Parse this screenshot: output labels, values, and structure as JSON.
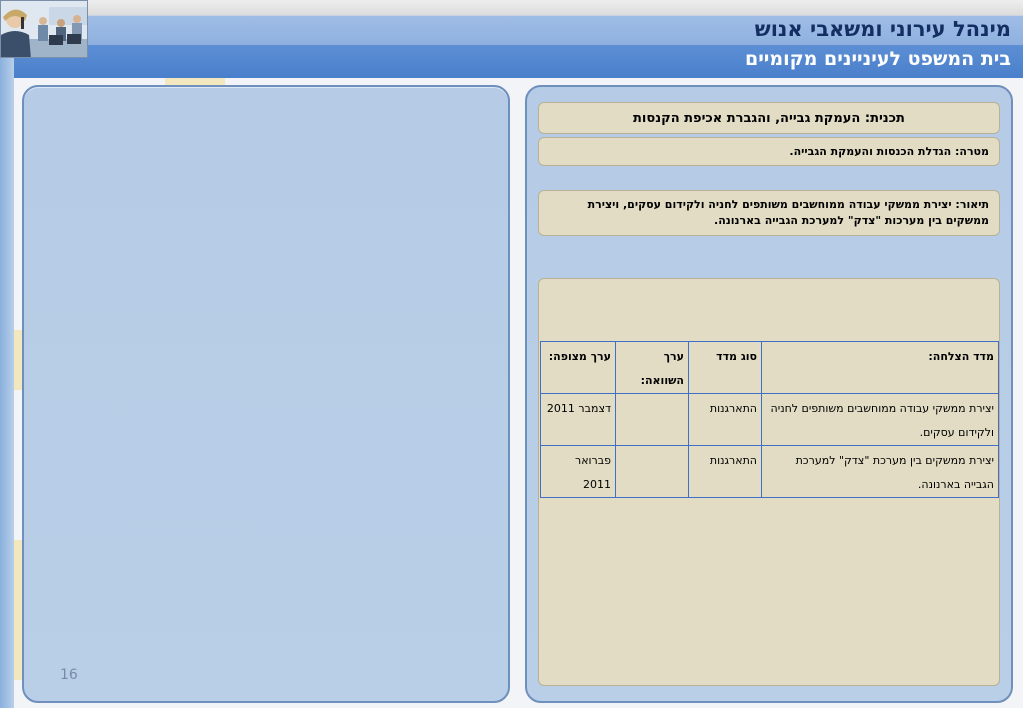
{
  "header": {
    "title": "מינהל עירוני ומשאבי אנוש",
    "subtitle": "בית המשפט לעיניינים מקומיים"
  },
  "plan": {
    "title": "תכנית: העמקת גבייה, והגברת אכיפת הקנסות",
    "goal": "מטרה: הגדלת הכנסות והעמקת הגבייה.",
    "description": "תיאור: יצירת ממשקי עבודה ממוחשבים משותפים לחניה ולקידום עסקים, ויצירת ממשקים בין מערכות \"צדק\" למערכת הגבייה בארנונה."
  },
  "table": {
    "headers": {
      "metric": "מדד הצלחה:",
      "type": "סוג מדד",
      "comparison": "ערך השוואה:",
      "expected": "ערך מצופה:"
    },
    "rows": [
      {
        "metric": "יצירת ממשקי עבודה ממוחשבים משותפים לחניה ולקידום עסקים.",
        "type": "התארגנות",
        "comparison": "",
        "expected": "דצמבר 2011"
      },
      {
        "metric": "יצירת ממשקים בין מערכת \"צדק\" למערכת הגבייה בארנונה.",
        "type": "התארגנות",
        "comparison": "",
        "expected": "פברואר 2011"
      }
    ]
  },
  "footer": {
    "page_number": "16"
  }
}
